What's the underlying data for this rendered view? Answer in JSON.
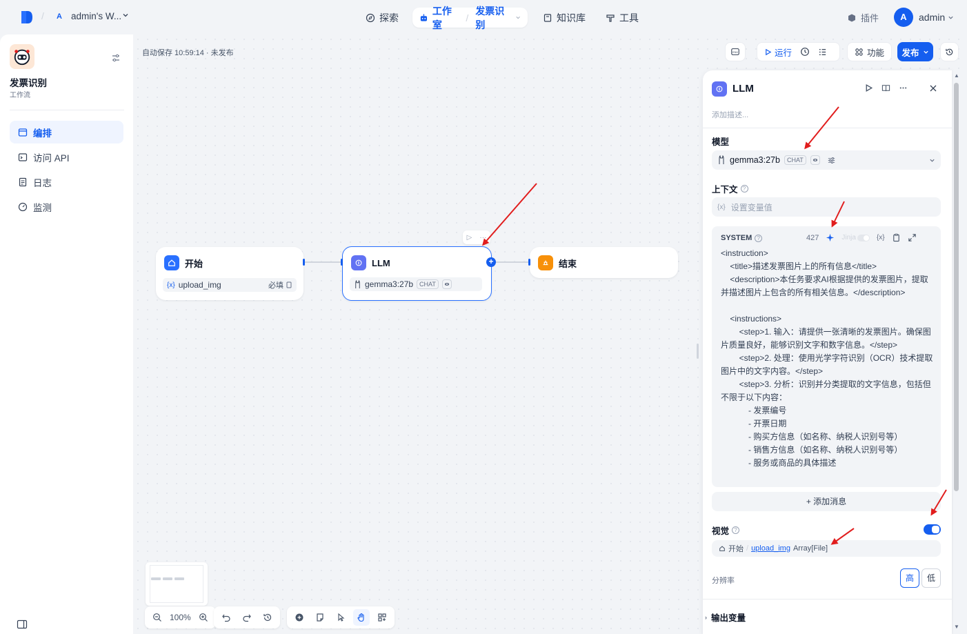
{
  "topbar": {
    "workspace_initial": "A",
    "workspace_name": "admin's W...",
    "nav_explore": "探索",
    "nav_studio": "工作室",
    "nav_studio_app": "发票识别",
    "nav_knowledge": "知识库",
    "nav_tools": "工具",
    "plugins": "插件",
    "user_initial": "A",
    "user_name": "admin"
  },
  "sidebar": {
    "app_title": "发票识别",
    "app_type": "工作流",
    "items": [
      {
        "label": "编排",
        "icon": "layout-icon",
        "active": true
      },
      {
        "label": "访问 API",
        "icon": "terminal-icon",
        "active": false
      },
      {
        "label": "日志",
        "icon": "log-icon",
        "active": false
      },
      {
        "label": "监测",
        "icon": "monitor-icon",
        "active": false
      }
    ]
  },
  "canvas": {
    "autosave": "自动保存 10:59:14 · 未发布",
    "zoom": "100%",
    "nodes": {
      "start": {
        "title": "开始",
        "var": "upload_img",
        "required": "必填"
      },
      "llm": {
        "title": "LLM",
        "model": "gemma3:27b",
        "tag": "CHAT"
      },
      "end": {
        "title": "结束"
      }
    }
  },
  "toolbar": {
    "env": "ENV",
    "run": "运行",
    "features": "功能",
    "publish": "发布"
  },
  "panel": {
    "title": "LLM",
    "description_placeholder": "添加描述...",
    "model_label": "模型",
    "model_name": "gemma3:27b",
    "model_tag": "CHAT",
    "context_label": "上下文",
    "context_placeholder": "设置变量值",
    "system_label": "SYSTEM",
    "token_count": "427",
    "jinja": "Jinja",
    "system_prompt": "<instruction>\n    <title>描述发票图片上的所有信息</title>\n    <description>本任务要求AI根据提供的发票图片，提取并描述图片上包含的所有相关信息。</description>\n\n    <instructions>\n        <step>1. 输入：请提供一张清晰的发票图片。确保图片质量良好，能够识别文字和数字信息。</step>\n        <step>2. 处理：使用光学字符识别（OCR）技术提取图片中的文字内容。</step>\n        <step>3. 分析：识别并分类提取的文字信息，包括但不限于以下内容：\n            - 发票编号\n            - 开票日期\n            - 购买方信息（如名称、纳税人识别号等）\n            - 销售方信息（如名称、纳税人识别号等）\n            - 服务或商品的具体描述",
    "add_message": "+ 添加消息",
    "vision_label": "视觉",
    "vision_enabled": true,
    "vision_source_node": "开始",
    "vision_var": "upload_img",
    "vision_type": "Array[File]",
    "resolution_label": "分辨率",
    "res_high": "高",
    "res_low": "低",
    "output_label": "输出变量"
  },
  "colors": {
    "accent": "#155eef",
    "llm_icon": "#6172f3",
    "end_icon": "#f79009",
    "annotation_arrow": "#e11d1d"
  }
}
